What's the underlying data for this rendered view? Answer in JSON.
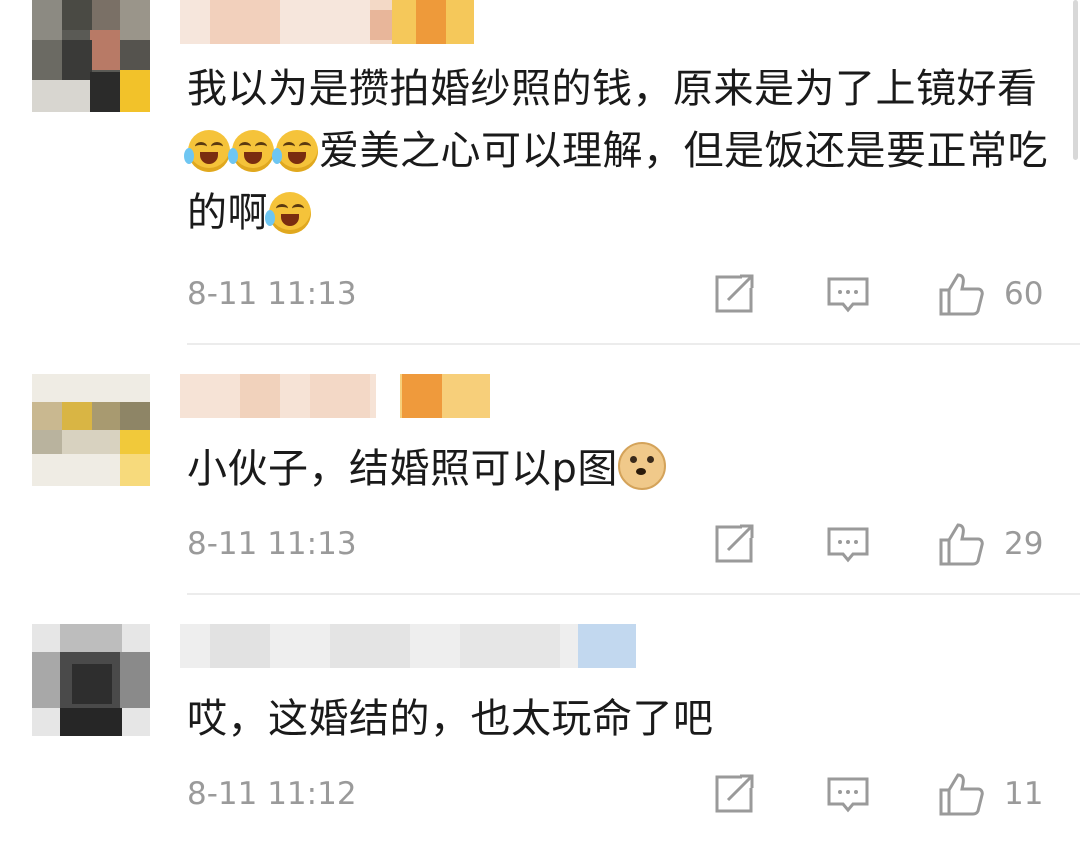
{
  "comments": [
    {
      "text": "我以为是攒拍婚纱照的钱，原来是为了上镜好看",
      "text_after_emoji": "爱美之心可以理解，但是饭还是要正常吃的啊",
      "emoji_count_mid": 3,
      "emoji_end": "laugh-cry-emoji",
      "time": "8-11 11:13",
      "likes": "60"
    },
    {
      "text": "小伙子，结婚照可以p图",
      "emoji_end": "doge-emoji",
      "time": "8-11 11:13",
      "likes": "29"
    },
    {
      "text": "哎，这婚结的，也太玩命了吧",
      "time": "8-11 11:12",
      "likes": "11"
    }
  ],
  "colors": {
    "meta": "#9a9a9a",
    "divider": "#ececec",
    "text": "#1a1a1a"
  }
}
